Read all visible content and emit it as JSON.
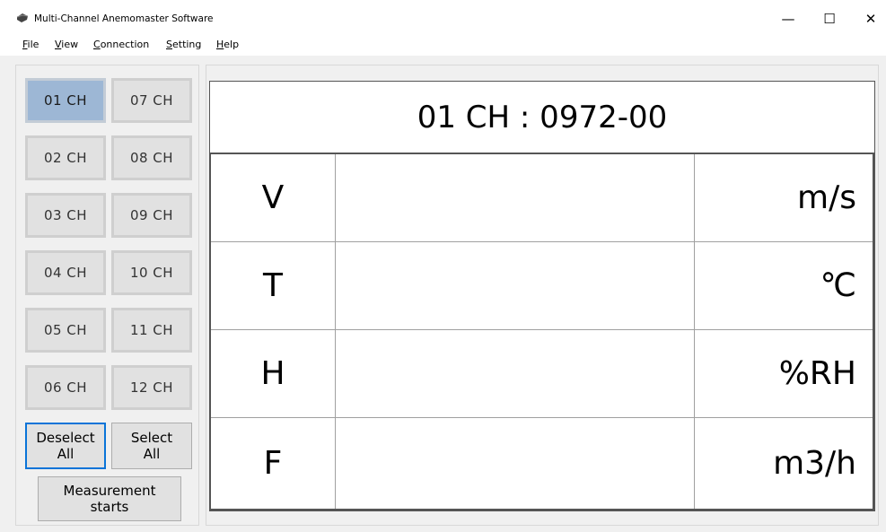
{
  "window": {
    "title": "Multi-Channel Anemomaster Software",
    "icon": "app-icon",
    "controls": {
      "minimize": "—",
      "maximize": "☐",
      "close": "✕"
    }
  },
  "menu": {
    "file": "File",
    "view": "View",
    "connection": "Connection",
    "setting": "Setting",
    "help": "Help"
  },
  "channels": {
    "ch01": "01 CH",
    "ch02": "02 CH",
    "ch03": "03 CH",
    "ch04": "04 CH",
    "ch05": "05 CH",
    "ch06": "06 CH",
    "ch07": "07 CH",
    "ch08": "08 CH",
    "ch09": "09 CH",
    "ch10": "10 CH",
    "ch11": "11 CH",
    "ch12": "12 CH",
    "selected": "01 CH"
  },
  "actions": {
    "deselect_all": "Deselect\nAll",
    "select_all": "Select\nAll",
    "measurement": "Measurement\nstarts"
  },
  "display": {
    "header": "01 CH : 0972-00",
    "rows": [
      {
        "label": "V",
        "value": "",
        "unit": "m/s"
      },
      {
        "label": "T",
        "value": "",
        "unit": "℃"
      },
      {
        "label": "H",
        "value": "",
        "unit": "%RH"
      },
      {
        "label": "F",
        "value": "",
        "unit": "m3/h"
      }
    ]
  },
  "colors": {
    "selected_channel": "#9db7d5",
    "focus_border": "#0a74d8",
    "button_face": "#e1e1e1"
  }
}
